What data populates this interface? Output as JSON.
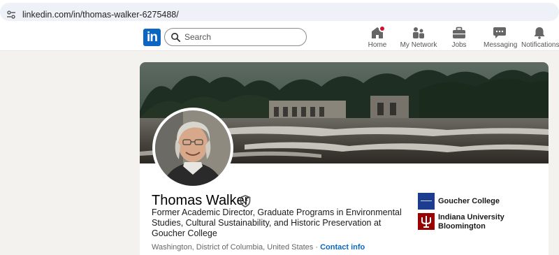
{
  "browser": {
    "url": "linkedin.com/in/thomas-walker-6275488/"
  },
  "nav": {
    "logo_text": "in",
    "search_placeholder": "Search",
    "items": [
      {
        "label": "Home",
        "icon": "home-icon"
      },
      {
        "label": "My Network",
        "icon": "network-icon"
      },
      {
        "label": "Jobs",
        "icon": "briefcase-icon"
      },
      {
        "label": "Messaging",
        "icon": "messaging-icon"
      },
      {
        "label": "Notifications",
        "icon": "bell-icon"
      }
    ],
    "colors": {
      "brand": "#0a66c2",
      "notification": "#cb112d"
    }
  },
  "profile": {
    "name": "Thomas Walker",
    "headline": "Former Academic Director, Graduate Programs in Environmental Studies, Cultural Sustainability, and Historic Preservation at Goucher College",
    "location": "Washington, District of Columbia, United States",
    "separator": "·",
    "contact_link": "Contact info",
    "organizations": [
      {
        "name": "Goucher College",
        "logo": "goucher-logo"
      },
      {
        "name": "Indiana University Bloomington",
        "logo": "iu-trident-logo"
      }
    ]
  }
}
